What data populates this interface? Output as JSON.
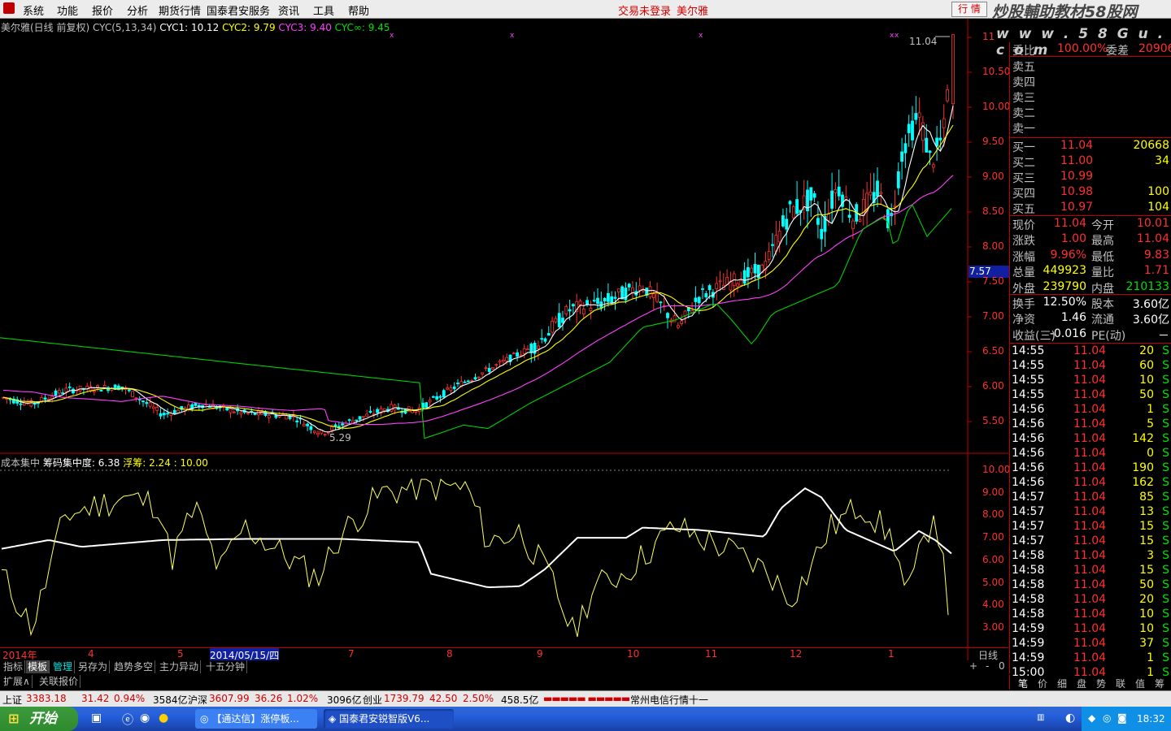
{
  "menubar": {
    "items": [
      "系统",
      "功能",
      "报价",
      "分析",
      "期货行情",
      "国泰君安服务",
      "资讯",
      "工具",
      "帮助"
    ],
    "status_login": "交易未登录",
    "stock_name": "美尔雅",
    "trade_button": "行 情",
    "watermark": "炒股輔助教材58股网",
    "watermark_url": "w w w . 5 8 G u . c o m"
  },
  "kline_header": {
    "title": "美尔雅(日线 前复权)",
    "cyc_params": "CYC(5,13,34)",
    "cyc1": "CYC1: 10.12",
    "cyc2": "CYC2: 9.79",
    "cyc3": "CYC3: 9.40",
    "cycinf": "CYC∞: 9.45",
    "high_label": "11.04",
    "low_label": "5.29",
    "current_marker": "7.57"
  },
  "price_axis": [
    "11",
    "10.50",
    "10.00",
    "9.50",
    "9.00",
    "8.50",
    "8.00",
    "7.50",
    "7.00",
    "6.50",
    "6.00",
    "5.50"
  ],
  "indicator_header": {
    "name": "成本集中",
    "conc": "筹码集中度: 6.38",
    "float": "浮筹: 2.24",
    "level": ": 10.00"
  },
  "indicator_axis": [
    "10.00",
    "9.00",
    "8.00",
    "7.00",
    "6.00",
    "5.00",
    "4.00",
    "3.00"
  ],
  "date_axis": [
    "2014年",
    "4",
    "5",
    "2014/05/15/四",
    "7",
    "8",
    "9",
    "10",
    "11",
    "12",
    "1"
  ],
  "period_label": "日线",
  "chart_data": {
    "type": "candlestick",
    "price_range": [
      5.1,
      11.2
    ],
    "high": 11.04,
    "low": 5.29,
    "cyc": {
      "CYC1": 10.12,
      "CYC2": 9.79,
      "CYC3": 9.4,
      "CYCinf": 9.45
    },
    "indicator": {
      "name": "成本集中",
      "筹码集中度": 6.38,
      "浮筹": 2.24,
      "level": 10.0,
      "range": [
        2.5,
        10.2
      ]
    }
  },
  "quote": {
    "weibi": "委比",
    "weibi_val": "100.00%",
    "weicha": "委差",
    "weicha_val": "20906",
    "sell": [
      "卖五",
      "卖四",
      "卖三",
      "卖二",
      "卖一"
    ],
    "buy": [
      {
        "label": "买一",
        "price": "11.04",
        "vol": "20668"
      },
      {
        "label": "买二",
        "price": "11.00",
        "vol": "34"
      },
      {
        "label": "买三",
        "price": "10.99",
        "vol": ""
      },
      {
        "label": "买四",
        "price": "10.98",
        "vol": "100"
      },
      {
        "label": "买五",
        "price": "10.97",
        "vol": "104"
      }
    ],
    "stats": [
      {
        "l1": "现价",
        "v1": "11.04",
        "l2": "今开",
        "v2": "10.01"
      },
      {
        "l1": "涨跌",
        "v1": "1.00",
        "l2": "最高",
        "v2": "11.04"
      },
      {
        "l1": "涨幅",
        "v1": "9.96%",
        "l2": "最低",
        "v2": "9.83"
      },
      {
        "l1": "总量",
        "v1": "449923",
        "l2": "量比",
        "v2": "1.71"
      },
      {
        "l1": "外盘",
        "v1": "239790",
        "l2": "内盘",
        "v2": "210133"
      },
      {
        "l1": "换手",
        "v1": "12.50%",
        "l2": "股本",
        "v2": "3.60亿"
      },
      {
        "l1": "净资",
        "v1": "1.46",
        "l2": "流通",
        "v2": "3.60亿"
      },
      {
        "l1": "收益(三)",
        "v1": "-0.016",
        "l2": "PE(动)",
        "v2": "－"
      }
    ],
    "ticks": [
      {
        "t": "14:55",
        "p": "11.04",
        "v": "20",
        "s": "S"
      },
      {
        "t": "14:55",
        "p": "11.04",
        "v": "60",
        "s": "S"
      },
      {
        "t": "14:55",
        "p": "11.04",
        "v": "10",
        "s": "S"
      },
      {
        "t": "14:55",
        "p": "11.04",
        "v": "50",
        "s": "S"
      },
      {
        "t": "14:56",
        "p": "11.04",
        "v": "1",
        "s": "S"
      },
      {
        "t": "14:56",
        "p": "11.04",
        "v": "5",
        "s": "S"
      },
      {
        "t": "14:56",
        "p": "11.04",
        "v": "142",
        "s": "S"
      },
      {
        "t": "14:56",
        "p": "11.04",
        "v": "0",
        "s": "S"
      },
      {
        "t": "14:56",
        "p": "11.04",
        "v": "190",
        "s": "S"
      },
      {
        "t": "14:56",
        "p": "11.04",
        "v": "162",
        "s": "S"
      },
      {
        "t": "14:57",
        "p": "11.04",
        "v": "85",
        "s": "S"
      },
      {
        "t": "14:57",
        "p": "11.04",
        "v": "13",
        "s": "S"
      },
      {
        "t": "14:57",
        "p": "11.04",
        "v": "15",
        "s": "S"
      },
      {
        "t": "14:57",
        "p": "11.04",
        "v": "15",
        "s": "S"
      },
      {
        "t": "14:58",
        "p": "11.04",
        "v": "3",
        "s": "S"
      },
      {
        "t": "14:58",
        "p": "11.04",
        "v": "15",
        "s": "S"
      },
      {
        "t": "14:58",
        "p": "11.04",
        "v": "50",
        "s": "S"
      },
      {
        "t": "14:58",
        "p": "11.04",
        "v": "20",
        "s": "S"
      },
      {
        "t": "14:58",
        "p": "11.04",
        "v": "10",
        "s": "S"
      },
      {
        "t": "14:59",
        "p": "11.04",
        "v": "10",
        "s": "S"
      },
      {
        "t": "14:59",
        "p": "11.04",
        "v": "37",
        "s": "S"
      },
      {
        "t": "14:59",
        "p": "11.04",
        "v": "1",
        "s": "S"
      },
      {
        "t": "15:00",
        "p": "11.04",
        "v": "1",
        "s": "S"
      }
    ],
    "bottom_tabs": [
      "笔",
      "价",
      "细",
      "盘",
      "势",
      "联",
      "值",
      "筹"
    ]
  },
  "tabs_row1": [
    "指标",
    "模板",
    "管理",
    "另存为",
    "趋势多空",
    "主力异动",
    "十五分钟"
  ],
  "tabs_row2": [
    "扩展∧",
    "关联报价"
  ],
  "statusbar": {
    "sh_label": "上证",
    "sh_val": "3383.18",
    "sh_chg": "31.42",
    "sh_pct": "0.94%",
    "sh_amt": "3584亿",
    "sz_label": "沪深",
    "sz_val": "3607.99",
    "sz_chg": "36.26",
    "sz_pct": "1.02%",
    "sz_amt": "3096亿",
    "cy_label": "创业",
    "cy_val": "1739.79",
    "cy_chg": "42.50",
    "cy_pct": "2.50%",
    "cy_amt": "458.5亿",
    "server": "常州电信行情十一"
  },
  "taskbar": {
    "start": "开始",
    "task1": "【通达信】涨停板...",
    "task2": "国泰君安锐智版V6...",
    "clock": "18:32"
  },
  "colors": {
    "up": "#ff3030",
    "down": "#00ffff",
    "ma5": "#ffffff",
    "ma13": "#ffff00",
    "ma34": "#ff40ff",
    "mainf": "#00d000",
    "border": "#c00000"
  }
}
